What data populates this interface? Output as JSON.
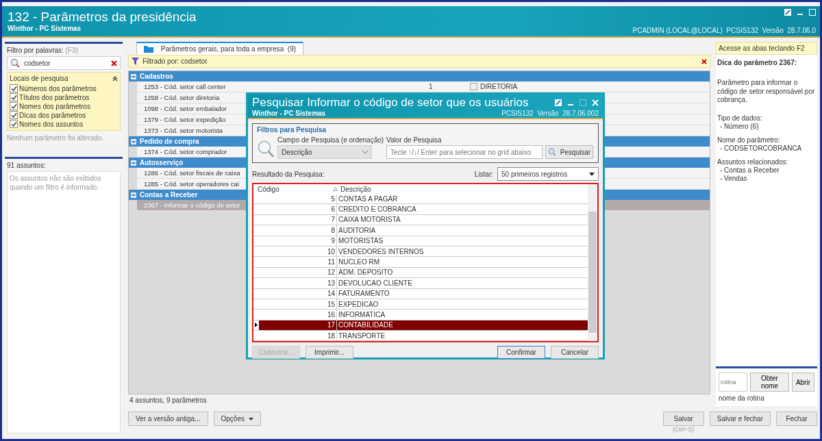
{
  "window": {
    "title": "132 - Parâmetros da presidência",
    "subtitle": "Winthor - PC Sistemas",
    "user_info": "PCADMIN (LOCAL@LOCAL)  PCSIS132  Versão  28.7.06.0"
  },
  "filter": {
    "label": "Filtro por palavras:",
    "shortcut": "(F3)",
    "value": "codsetor"
  },
  "search_locations": {
    "title": "Locais de pesquisa",
    "expanded": true,
    "options": [
      {
        "label": "Números dos parâmetros",
        "checked": true
      },
      {
        "label": "Títulos dos parâmetros",
        "checked": true
      },
      {
        "label": "Nomes dos parâmetros",
        "checked": true
      },
      {
        "label": "Dicas dos parâmetros",
        "checked": true
      },
      {
        "label": "Nomes dos assuntos",
        "checked": true
      }
    ],
    "status": "Nenhum parâmetro foi alterado."
  },
  "subjects": {
    "count_label": "91 assuntos:",
    "note": "Os assuntos não são exibidos quando um filtro é informado."
  },
  "tabs": [
    {
      "label": "Parâmetros gerais, para toda a empresa  (9)",
      "selected": true
    }
  ],
  "filter_bar": {
    "text": "Filtrado por: codsetor"
  },
  "groups": [
    {
      "name": "Cadastros",
      "expanded": true,
      "items": [
        {
          "label": "1253 - Cód. setor call center",
          "value": "1",
          "description": "DIRETORIA",
          "selected": false
        },
        {
          "label": "1258 - Cód. setor diretoria",
          "selected": false
        },
        {
          "label": "1098 - Cód. setor embalador",
          "selected": false
        },
        {
          "label": "1379 - Cód. setor expedição",
          "selected": false
        },
        {
          "label": "1373 - Cód. setor motorista",
          "selected": false
        }
      ]
    },
    {
      "name": "Pedido de compra",
      "expanded": true,
      "items": [
        {
          "label": "1374 - Cód. setor comprador",
          "selected": false
        }
      ]
    },
    {
      "name": "Autosserviço",
      "expanded": true,
      "items": [
        {
          "label": "1286 - Cód. setor fiscais de caixa",
          "selected": false
        },
        {
          "label": "1285 - Cód. setor operadores cai",
          "selected": false
        }
      ]
    },
    {
      "name": "Contas a Receber",
      "expanded": true,
      "items": [
        {
          "label": "2367 - Informar o código de setor",
          "selected": true
        }
      ]
    }
  ],
  "list_footer": "4 assuntos, 9 parâmetros",
  "left_buttons": [
    "Ver a versão antiga...",
    "Opções"
  ],
  "tip": {
    "hint": "Acesse as abas teclando F2",
    "title": "Dica do parâmetro 2367:",
    "text": "Parâmetro para informar o código de setor responsável por cobrança.",
    "sections": [
      {
        "label": "Tipo de dados:",
        "items": [
          "- Número (6)"
        ]
      },
      {
        "label": "Nome do parâmetro:",
        "items": [
          "- CODSETORCOBRANCA"
        ]
      },
      {
        "label": "Assuntos relacionados:",
        "items": [
          "- Contas a Receber",
          "- Vendas"
        ]
      }
    ]
  },
  "routine": {
    "placeholder": "rotina",
    "buttons": [
      "Obter nome",
      "Abrir"
    ],
    "name_label": "nome da rotina"
  },
  "right_buttons": [
    {
      "label": "Salvar",
      "shortcut": "(Ctrl+S)"
    },
    {
      "label": "Salvar e fechar"
    },
    {
      "label": "Fechar"
    }
  ],
  "dialog": {
    "title": "Pesquisar Informar o código de setor que os usuários",
    "subtitle": "Winthor - PC Sistemas",
    "version": "PCSIS132  Versão  28.7.06.002",
    "filters_title": "Filtros para Pesquisa",
    "field_label": "Campo de Pesquisa (e ordenação)",
    "field_value": "Descrição",
    "value_label": "Valor de Pesquisa",
    "value_placeholder": "Tecle ↑/↓/ Enter para selecionar no grid abaixo",
    "search_button": "Pesquisar",
    "result_label": "Resultado da Pesquisa:",
    "list_label": "Listar:",
    "list_value": "50 primeiros registros",
    "columns": [
      "Código",
      "Descrição"
    ],
    "rows": [
      {
        "code": "5",
        "description": "CONTAS A PAGAR",
        "selected": false
      },
      {
        "code": "6",
        "description": "CREDITO E COBRANCA",
        "selected": false
      },
      {
        "code": "7",
        "description": "CAIXA MOTORISTA",
        "selected": false
      },
      {
        "code": "8",
        "description": "AUDITORIA",
        "selected": false
      },
      {
        "code": "9",
        "description": "MOTORISTAS",
        "selected": false
      },
      {
        "code": "10",
        "description": "VENDEDORES INTERNOS",
        "selected": false
      },
      {
        "code": "11",
        "description": "NUCLEO RM",
        "selected": false
      },
      {
        "code": "12",
        "description": "ADM. DEPOSITO",
        "selected": false
      },
      {
        "code": "13",
        "description": "DEVOLUCAO CLIENTE",
        "selected": false
      },
      {
        "code": "14",
        "description": "FATURAMENTO",
        "selected": false
      },
      {
        "code": "15",
        "description": "EXPEDICAO",
        "selected": false
      },
      {
        "code": "16",
        "description": "INFORMATICA",
        "selected": false
      },
      {
        "code": "17",
        "description": "CONTABILIDADE",
        "selected": true
      },
      {
        "code": "18",
        "description": "TRANSPORTE",
        "selected": false
      }
    ],
    "buttons": [
      {
        "label": "Cadastrar...",
        "disabled": true,
        "default": false
      },
      {
        "label": "Imprimir...",
        "disabled": false,
        "default": false
      },
      {
        "label": "Confirmar",
        "disabled": false,
        "default": true
      },
      {
        "label": "Cancelar",
        "disabled": false,
        "default": false
      }
    ]
  }
}
